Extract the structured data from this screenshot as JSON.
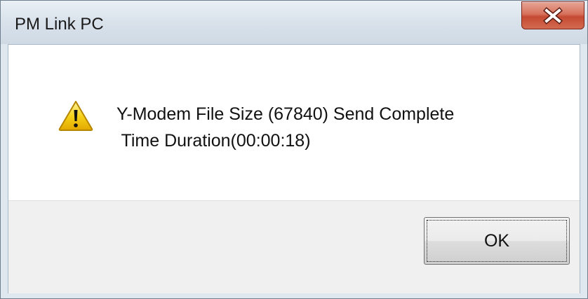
{
  "window": {
    "title": "PM Link PC",
    "close_icon": "close-icon"
  },
  "message": {
    "icon": "warning-icon",
    "line1": "Y-Modem File Size (67840) Send Complete",
    "line2": " Time Duration(00:00:18)"
  },
  "buttons": {
    "ok_label": "OK"
  },
  "colors": {
    "close_button": "#c54a33",
    "warning_yellow": "#f5c400",
    "frame": "#dfe7ef"
  }
}
